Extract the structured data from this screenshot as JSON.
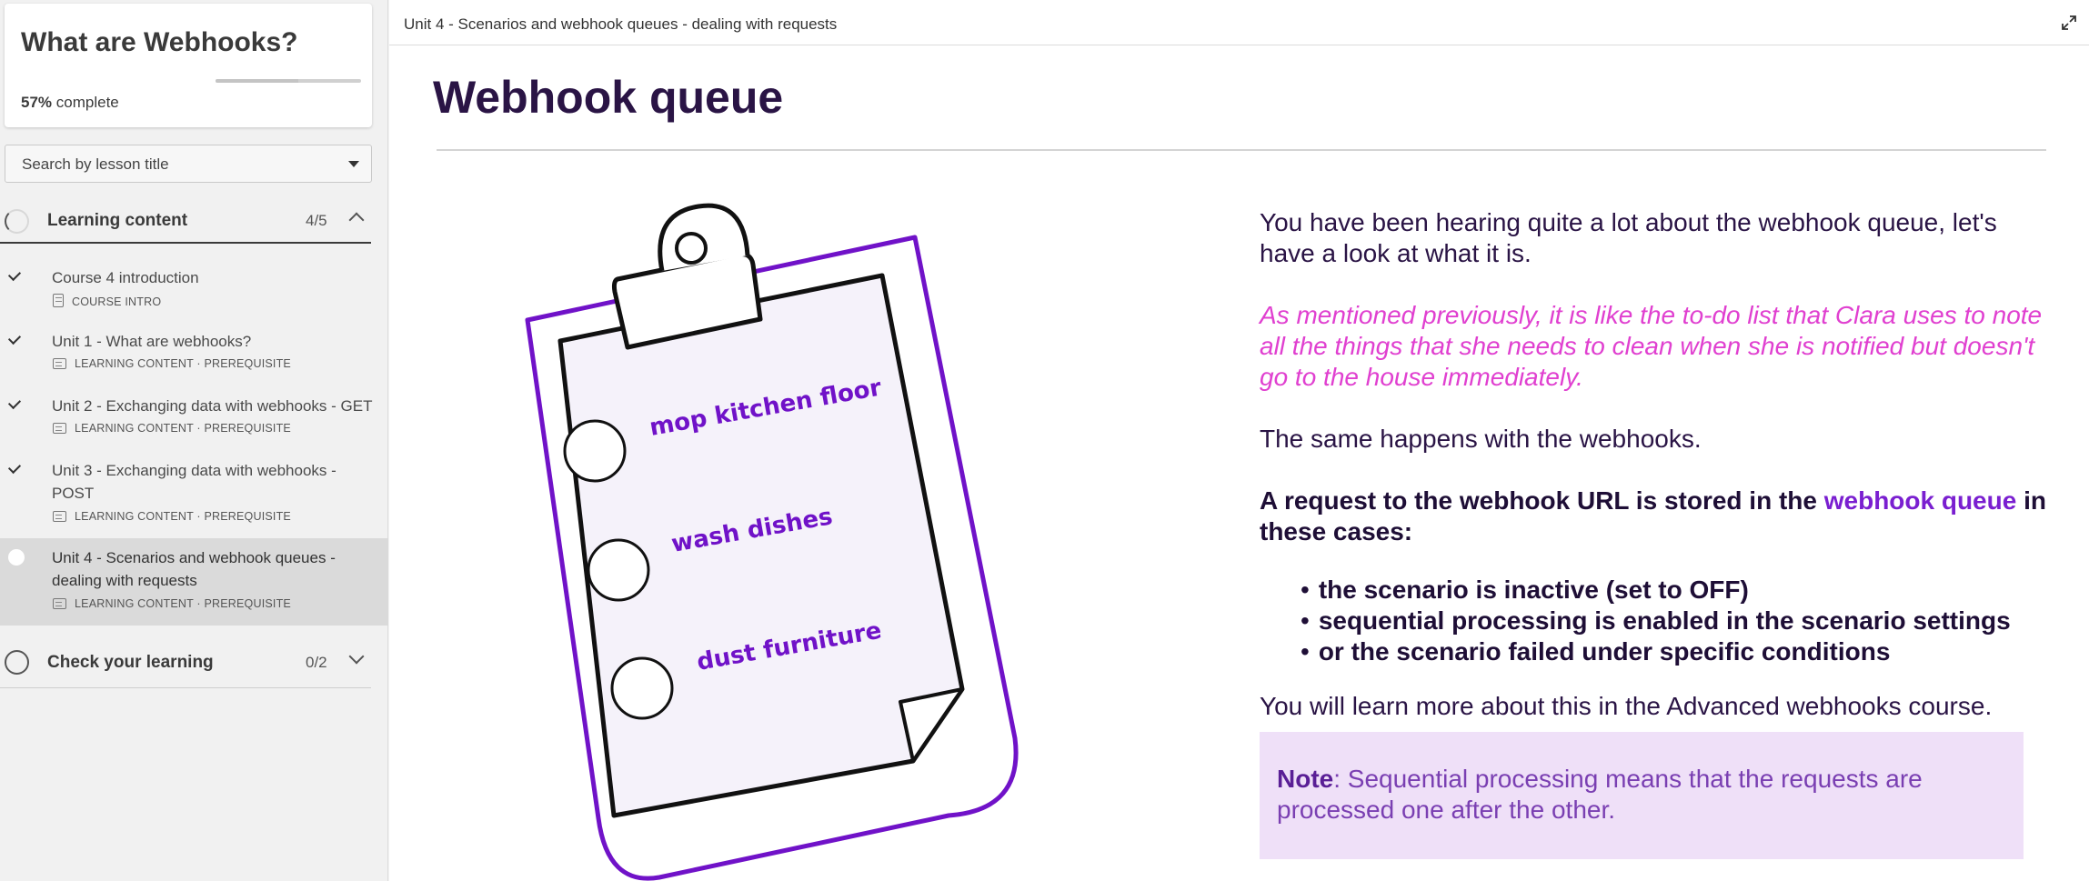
{
  "course": {
    "title": "What are Webhooks?",
    "progress_value": 57,
    "progress_pct_text": "57%",
    "progress_suffix": "complete"
  },
  "search": {
    "placeholder": "Search by lesson title"
  },
  "sections": [
    {
      "title": "Learning content",
      "count": "4/5"
    },
    {
      "title": "Check your learning",
      "count": "0/2"
    }
  ],
  "lessons": [
    {
      "title": "Course 4 introduction",
      "meta": "COURSE INTRO",
      "status": "complete"
    },
    {
      "title": "Unit 1 - What are webhooks?",
      "meta": "LEARNING CONTENT · PREREQUISITE",
      "status": "complete"
    },
    {
      "title": "Unit 2 - Exchanging data with webhooks - GET",
      "meta": "LEARNING CONTENT · PREREQUISITE",
      "status": "complete"
    },
    {
      "title": "Unit 3 - Exchanging data with webhooks - POST",
      "meta": "LEARNING CONTENT · PREREQUISITE",
      "status": "complete"
    },
    {
      "title": "Unit 4 - Scenarios and webhook queues - dealing with requests",
      "meta": "LEARNING CONTENT · PREREQUISITE",
      "status": "current"
    }
  ],
  "topbar": {
    "title": "Unit 4 - Scenarios and webhook queues - dealing with requests"
  },
  "page": {
    "title": "Webhook queue",
    "p1": "You have been hearing quite a lot about the webhook queue, let's have a look at what it is.",
    "p2": "As mentioned previously, it is like the to-do list that Clara uses to note all the things that she needs to clean when she is notified but doesn't go to the house immediately.",
    "p3": "The same happens with the webhooks.",
    "p4_start": "A request to the webhook URL is stored in the",
    "p4_highlight": "webhook queue",
    "p4_end": "in these cases:",
    "bullets": [
      "the scenario is inactive (set to OFF)",
      "sequential processing is enabled in the scenario settings",
      "or the scenario failed under specific conditions"
    ],
    "p5": "You will learn more about this in the Advanced webhooks course.",
    "note_label": "Note",
    "note_text": ": Sequential processing means that the requests are processed one after the other."
  },
  "illustration": {
    "items": [
      "mop kitchen floor",
      "wash dishes",
      "dust furniture"
    ],
    "accent": "#7012c8"
  },
  "colors": {
    "accent_purple": "#7a1fd0",
    "pink": "#e040d0",
    "title_dark": "#2a1445",
    "note_bg": "#efe0f8"
  }
}
